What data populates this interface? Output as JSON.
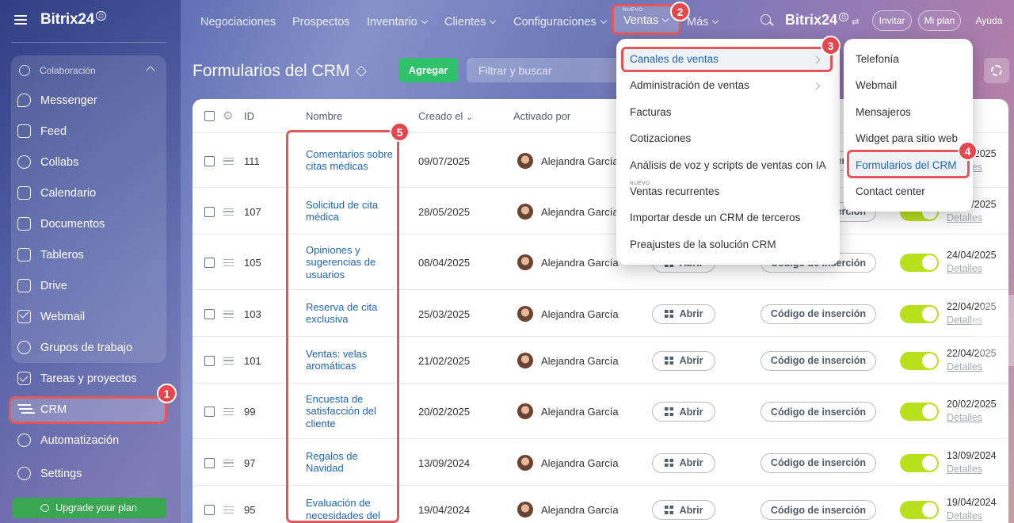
{
  "sidebar": {
    "brand": "Bitrix24",
    "group_label": "Colaboración",
    "items": [
      {
        "label": "Messenger",
        "icon": "chat-icon"
      },
      {
        "label": "Feed",
        "icon": "feed-icon"
      },
      {
        "label": "Collabs",
        "icon": "collabs-icon"
      },
      {
        "label": "Calendario",
        "icon": "calendar-icon"
      },
      {
        "label": "Documentos",
        "icon": "document-icon"
      },
      {
        "label": "Tableros",
        "icon": "board-icon"
      },
      {
        "label": "Drive",
        "icon": "drive-icon"
      },
      {
        "label": "Webmail",
        "icon": "mail-icon"
      },
      {
        "label": "Grupos de trabajo",
        "icon": "group-icon"
      },
      {
        "label": "Tareas y proyectos",
        "icon": "task-icon"
      },
      {
        "label": "CRM",
        "icon": "crm-icon"
      },
      {
        "label": "Automatización",
        "icon": "robot-icon"
      },
      {
        "label": "Settings",
        "icon": "gear-icon"
      }
    ],
    "upgrade": "Upgrade your plan"
  },
  "topbar": {
    "nav": [
      "Negociaciones",
      "Prospectos",
      "Inventario",
      "Clientes",
      "Configuraciones"
    ],
    "ventas_new": "NUEVO",
    "ventas": "Ventas",
    "mas": "Más",
    "brand": "Bitrix24",
    "invitar": "Invitar",
    "mi_plan": "Mi plan",
    "ayuda": "Ayuda"
  },
  "page": {
    "title": "Formularios del CRM",
    "add": "Agregar",
    "filter_placeholder": "Filtrar y buscar"
  },
  "table": {
    "headers": {
      "id": "ID",
      "name": "Nombre",
      "created": "Creado el",
      "activated": "Activado por"
    },
    "open_label": "Abrir",
    "embed_label": "Código de inserción",
    "details_label": "Detalles",
    "rows": [
      {
        "id": "111",
        "name": "Comentarios sobre citas médicas",
        "created": "09/07/2025",
        "person": "Alejandra García",
        "date": "09/07/2025"
      },
      {
        "id": "107",
        "name": "Solicitud de cita médica",
        "created": "28/05/2025",
        "person": "Alejandra García",
        "date": "28/05/2025"
      },
      {
        "id": "105",
        "name": "Opiniones y sugerencias de usuarios",
        "created": "08/04/2025",
        "person": "Alejandra García",
        "date": "24/04/2025"
      },
      {
        "id": "103",
        "name": "Reserva de cita exclusiva",
        "created": "25/03/2025",
        "person": "Alejandra García",
        "date": "22/04/2025"
      },
      {
        "id": "101",
        "name": "Ventas: velas aromáticas",
        "created": "21/02/2025",
        "person": "Alejandra García",
        "date": "22/04/2025"
      },
      {
        "id": "99",
        "name": "Encuesta de satisfacción del cliente",
        "created": "20/02/2025",
        "person": "Alejandra García",
        "date": "20/02/2025"
      },
      {
        "id": "97",
        "name": "Regalos de Navidad",
        "created": "13/09/2024",
        "person": "Alejandra García",
        "date": "13/09/2024"
      },
      {
        "id": "95",
        "name": "Evaluación de necesidades del",
        "created": "19/04/2024",
        "person": "Alejandra García",
        "date": "19/04/2024"
      }
    ]
  },
  "menu_ventas": {
    "items": [
      "Canales de ventas",
      "Administración de ventas",
      "Facturas",
      "Cotizaciones",
      "Análisis de voz y scripts de ventas con IA",
      "Ventas recurrentes",
      "Importar desde un CRM de terceros",
      "Preajustes de la solución CRM"
    ],
    "new_tag": "NUEVO"
  },
  "menu_canales": {
    "items": [
      "Telefonía",
      "Webmail",
      "Mensajeros",
      "Widget para sitio web",
      "Formularios del CRM",
      "Contact center"
    ]
  },
  "badges": [
    "1",
    "2",
    "3",
    "4",
    "5"
  ],
  "colors": {
    "accent_red": "#e2585a",
    "add_green": "#2fc26b",
    "link_blue": "#2067b0",
    "toggle_lime": "#b8e01c"
  }
}
